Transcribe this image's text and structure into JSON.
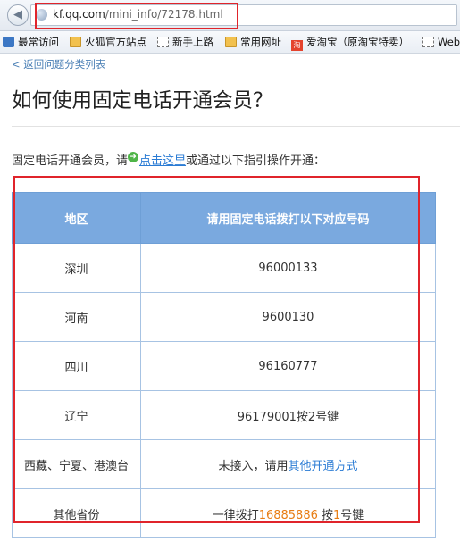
{
  "browser": {
    "url_host": "kf.qq.com",
    "url_path": "/mini_info/72178.html"
  },
  "bookmarks": [
    {
      "label": "最常访问",
      "icon": "bookmarks-icon"
    },
    {
      "label": "火狐官方站点",
      "icon": "folder-icon"
    },
    {
      "label": "新手上路",
      "icon": "page-icon"
    },
    {
      "label": "常用网址",
      "icon": "folder-icon"
    },
    {
      "label": "爱淘宝（原淘宝特卖）",
      "icon": "taobao-icon"
    },
    {
      "label": "Web",
      "icon": "page-icon"
    }
  ],
  "page": {
    "back_link": "< 返回问题分类列表",
    "title": "如何使用固定电话开通会员？",
    "intro_prefix": "固定电话开通会员，请",
    "intro_link": "点击这里",
    "intro_suffix": "或通过以下指引操作开通："
  },
  "table": {
    "headers": [
      "地区",
      "请用固定电话拨打以下对应号码"
    ],
    "rows": [
      {
        "region": "深圳",
        "number": "96000133"
      },
      {
        "region": "河南",
        "number": "9600130"
      },
      {
        "region": "四川",
        "number": "96160777"
      },
      {
        "region": "辽宁",
        "number": "96179001按2号键"
      },
      {
        "region": "西藏、宁夏、港澳台",
        "number_prefix": "未接入，请用",
        "number_link": "其他开通方式"
      },
      {
        "region": "其他省份",
        "number_prefix": "一律拨打",
        "number_orange": "16885886",
        "number_mid": " 按",
        "number_key": "1",
        "number_suffix": "号键"
      }
    ]
  },
  "colors": {
    "header_bg": "#7aa9df",
    "highlight_red": "#e0242b",
    "link_blue": "#2a7bd4",
    "accent_orange": "#e87d14"
  }
}
